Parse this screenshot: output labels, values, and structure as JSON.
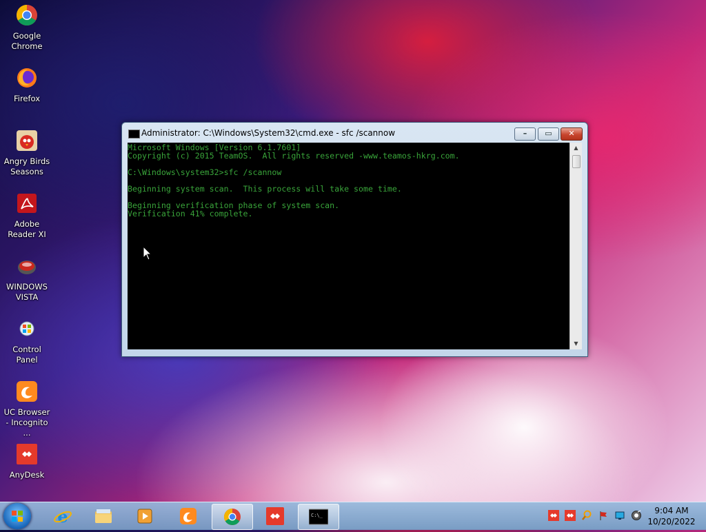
{
  "desktop": {
    "icons": [
      {
        "label": "Google Chrome",
        "icon": "chrome-icon"
      },
      {
        "label": "Firefox",
        "icon": "firefox-icon"
      },
      {
        "label": "Angry Birds Seasons",
        "icon": "angry-birds-icon"
      },
      {
        "label": "Adobe Reader XI",
        "icon": "adobe-reader-icon"
      },
      {
        "label": "WINDOWS VISTA",
        "icon": "windows-vista-icon"
      },
      {
        "label": "Control Panel",
        "icon": "control-panel-icon"
      },
      {
        "label": "UC Browser - Incognito ...",
        "icon": "uc-browser-icon"
      },
      {
        "label": "AnyDesk",
        "icon": "anydesk-icon"
      }
    ]
  },
  "window": {
    "title": "Administrator: C:\\Windows\\System32\\cmd.exe - sfc  /scannow",
    "console_lines": [
      "Microsoft Windows [Version 6.1.7601]",
      "Copyright (c) 2015 TeamOS.  All rights reserved -www.teamos-hkrg.com.",
      "",
      "C:\\Windows\\system32>sfc /scannow",
      "",
      "Beginning system scan.  This process will take some time.",
      "",
      "Beginning verification phase of system scan.",
      "Verification 41% complete."
    ],
    "controls": {
      "minimize": "minimize",
      "maximize": "maximize",
      "close": "close"
    }
  },
  "taskbar": {
    "buttons": [
      {
        "app": "Internet Explorer",
        "icon": "internet-explorer-icon"
      },
      {
        "app": "Windows Explorer",
        "icon": "file-explorer-icon"
      },
      {
        "app": "Windows Media Player",
        "icon": "media-player-icon"
      },
      {
        "app": "UC Browser",
        "icon": "uc-browser-icon"
      },
      {
        "app": "Google Chrome",
        "icon": "chrome-icon"
      },
      {
        "app": "AnyDesk",
        "icon": "anydesk-icon"
      },
      {
        "app": "Command Prompt",
        "icon": "cmd-icon"
      }
    ],
    "clock": {
      "time": "9:04 AM",
      "date": "10/20/2022"
    }
  },
  "colors": {
    "console_text": "#39a43a",
    "console_bg": "#000000",
    "taskbar": "#8fb4da",
    "anydesk_red": "#e53a2b"
  }
}
